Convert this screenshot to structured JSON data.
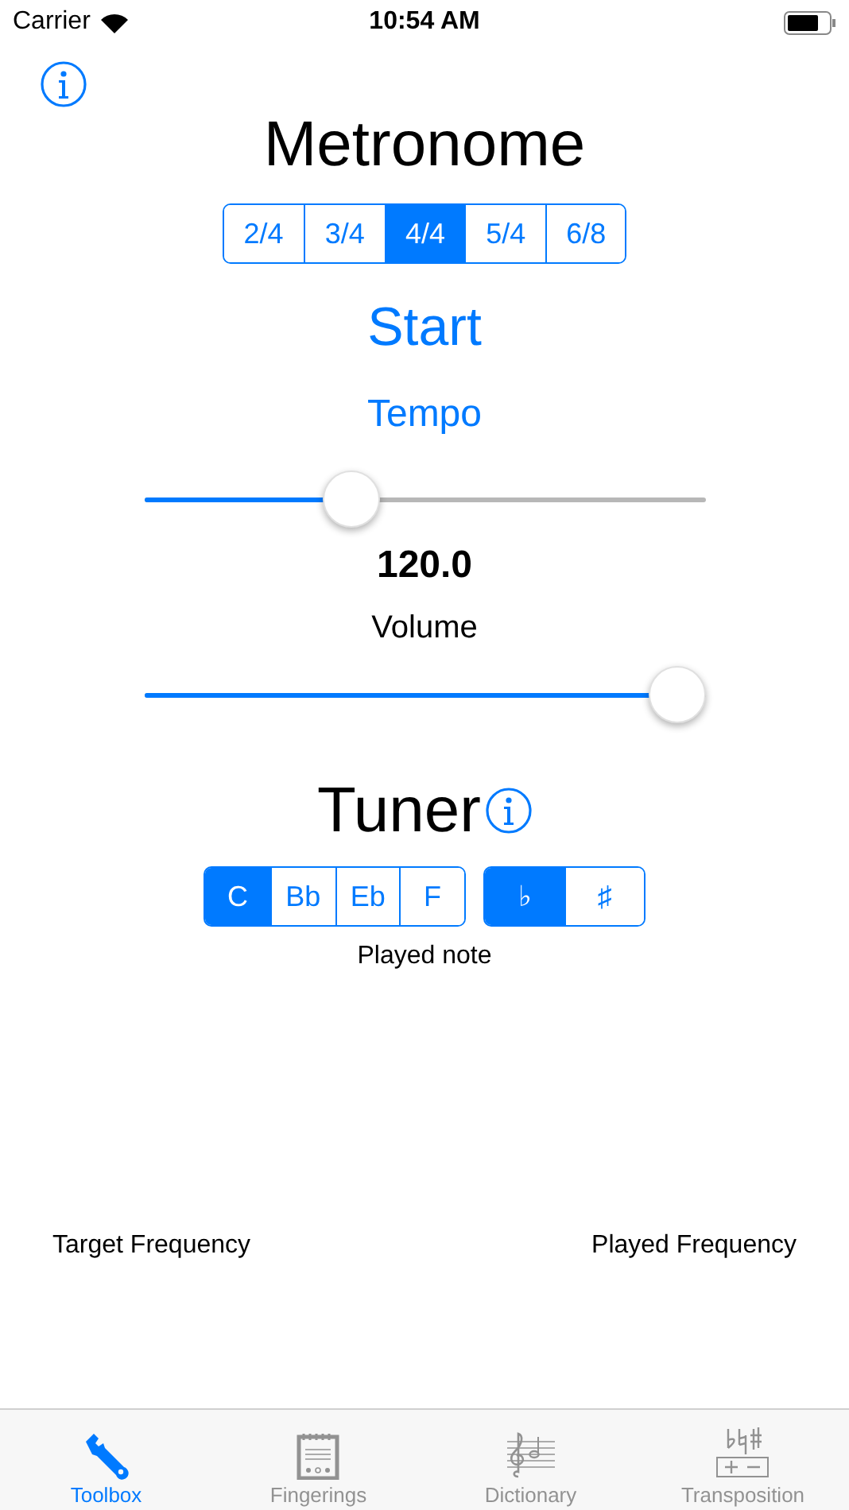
{
  "status_bar": {
    "carrier": "Carrier",
    "time": "10:54 AM"
  },
  "title": "Metronome",
  "meters": [
    {
      "label": "2/4",
      "selected": false
    },
    {
      "label": "3/4",
      "selected": false
    },
    {
      "label": "4/4",
      "selected": true
    },
    {
      "label": "5/4",
      "selected": false
    },
    {
      "label": "6/8",
      "selected": false
    }
  ],
  "start_button": "Start",
  "tempo": {
    "label": "Tempo",
    "level": 0.37,
    "reading": "120.0"
  },
  "volume": {
    "label": "Volume",
    "level": 0.95
  },
  "tuner": {
    "title": "Tuner",
    "keys": [
      {
        "label": "C",
        "selected": true
      },
      {
        "label": "Bb",
        "selected": false
      },
      {
        "label": "Eb",
        "selected": false
      },
      {
        "label": "F",
        "selected": false
      }
    ],
    "accidentals": [
      {
        "label": "♭",
        "selected": true
      },
      {
        "label": "♯",
        "selected": false
      }
    ],
    "played_note_label": "Played note",
    "target_frequency_label": "Target Frequency",
    "played_frequency_label": "Played Frequency"
  },
  "tabs": [
    {
      "label": "Toolbox",
      "kind": "wrench",
      "selected": true
    },
    {
      "label": "Fingerings",
      "kind": "notepad",
      "selected": false
    },
    {
      "label": "Dictionary",
      "kind": "staff",
      "selected": false
    },
    {
      "label": "Transposition",
      "kind": "accidentals",
      "selected": false
    }
  ]
}
